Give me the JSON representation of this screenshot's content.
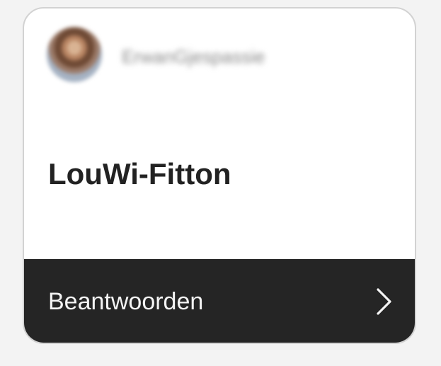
{
  "card": {
    "username": "ErwanGjespassie",
    "title": "LouWi-Fitton",
    "action_label": "Beantwoorden",
    "action_icon": "chevron-right-icon"
  },
  "colors": {
    "page_background": "#f3f3f3",
    "card_background": "#ffffff",
    "card_border": "#d2d2d2",
    "title_text": "#222222",
    "action_background": "#252525",
    "action_text": "#f4f4f4"
  }
}
